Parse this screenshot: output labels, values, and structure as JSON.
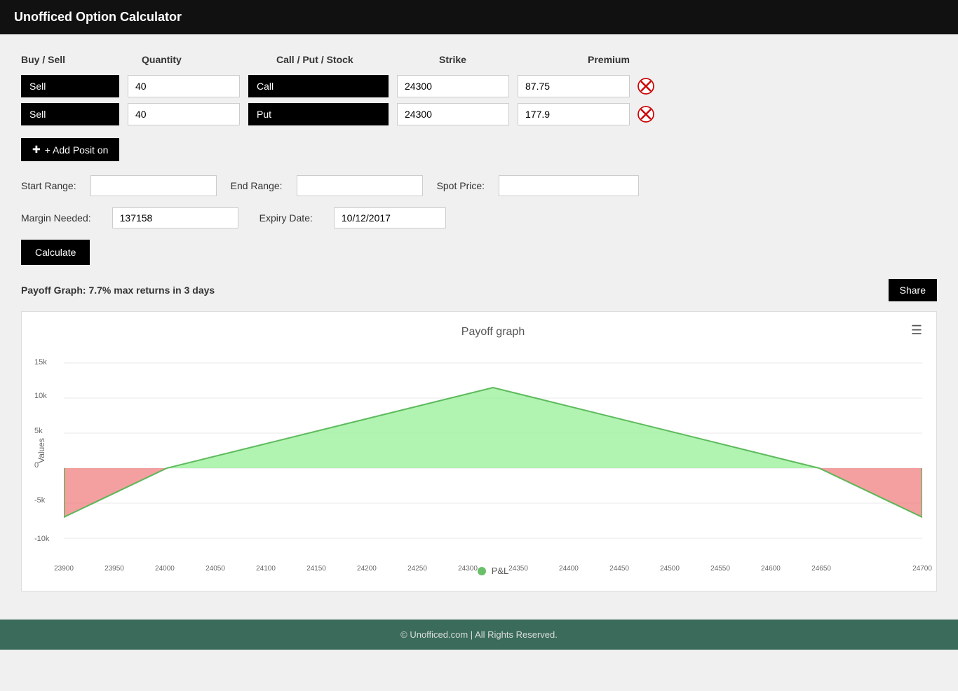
{
  "header": {
    "title": "Unofficed Option Calculator"
  },
  "columns": {
    "buysell": "Buy / Sell",
    "quantity": "Quantity",
    "type": "Call / Put / Stock",
    "strike": "Strike",
    "premium": "Premium"
  },
  "positions": [
    {
      "buysell": "Sell",
      "quantity": "40",
      "type": "Call",
      "strike": "24300",
      "premium": "87.75"
    },
    {
      "buysell": "Sell",
      "quantity": "40",
      "type": "Put",
      "strike": "24300",
      "premium": "177.9"
    }
  ],
  "add_position_btn": "+ Add Posit on",
  "range": {
    "start_label": "Start Range:",
    "start_value": "",
    "end_label": "End Range:",
    "end_value": "",
    "spot_label": "Spot Price:",
    "spot_value": ""
  },
  "margin": {
    "label": "Margin Needed:",
    "value": "137158",
    "expiry_label": "Expiry Date:",
    "expiry_value": "10/12/2017"
  },
  "calculate_btn": "Calculate",
  "payoff": {
    "description": "Payoff Graph: 7.7% max returns in 3 days",
    "share_btn": "Share",
    "chart_title": "Payoff graph",
    "y_axis_label": "Values",
    "legend_label": "P&L",
    "x_labels": [
      "23900",
      "23950",
      "24000",
      "24050",
      "24100",
      "24150",
      "24200",
      "24250",
      "24300",
      "24350",
      "24400",
      "24450",
      "24500",
      "24550",
      "24600",
      "24650",
      "24700"
    ],
    "y_labels": [
      "15k",
      "10k",
      "5k",
      "0",
      "-5k",
      "-10k"
    ]
  },
  "footer": {
    "text": "© Unofficed.com | All Rights Reserved."
  }
}
